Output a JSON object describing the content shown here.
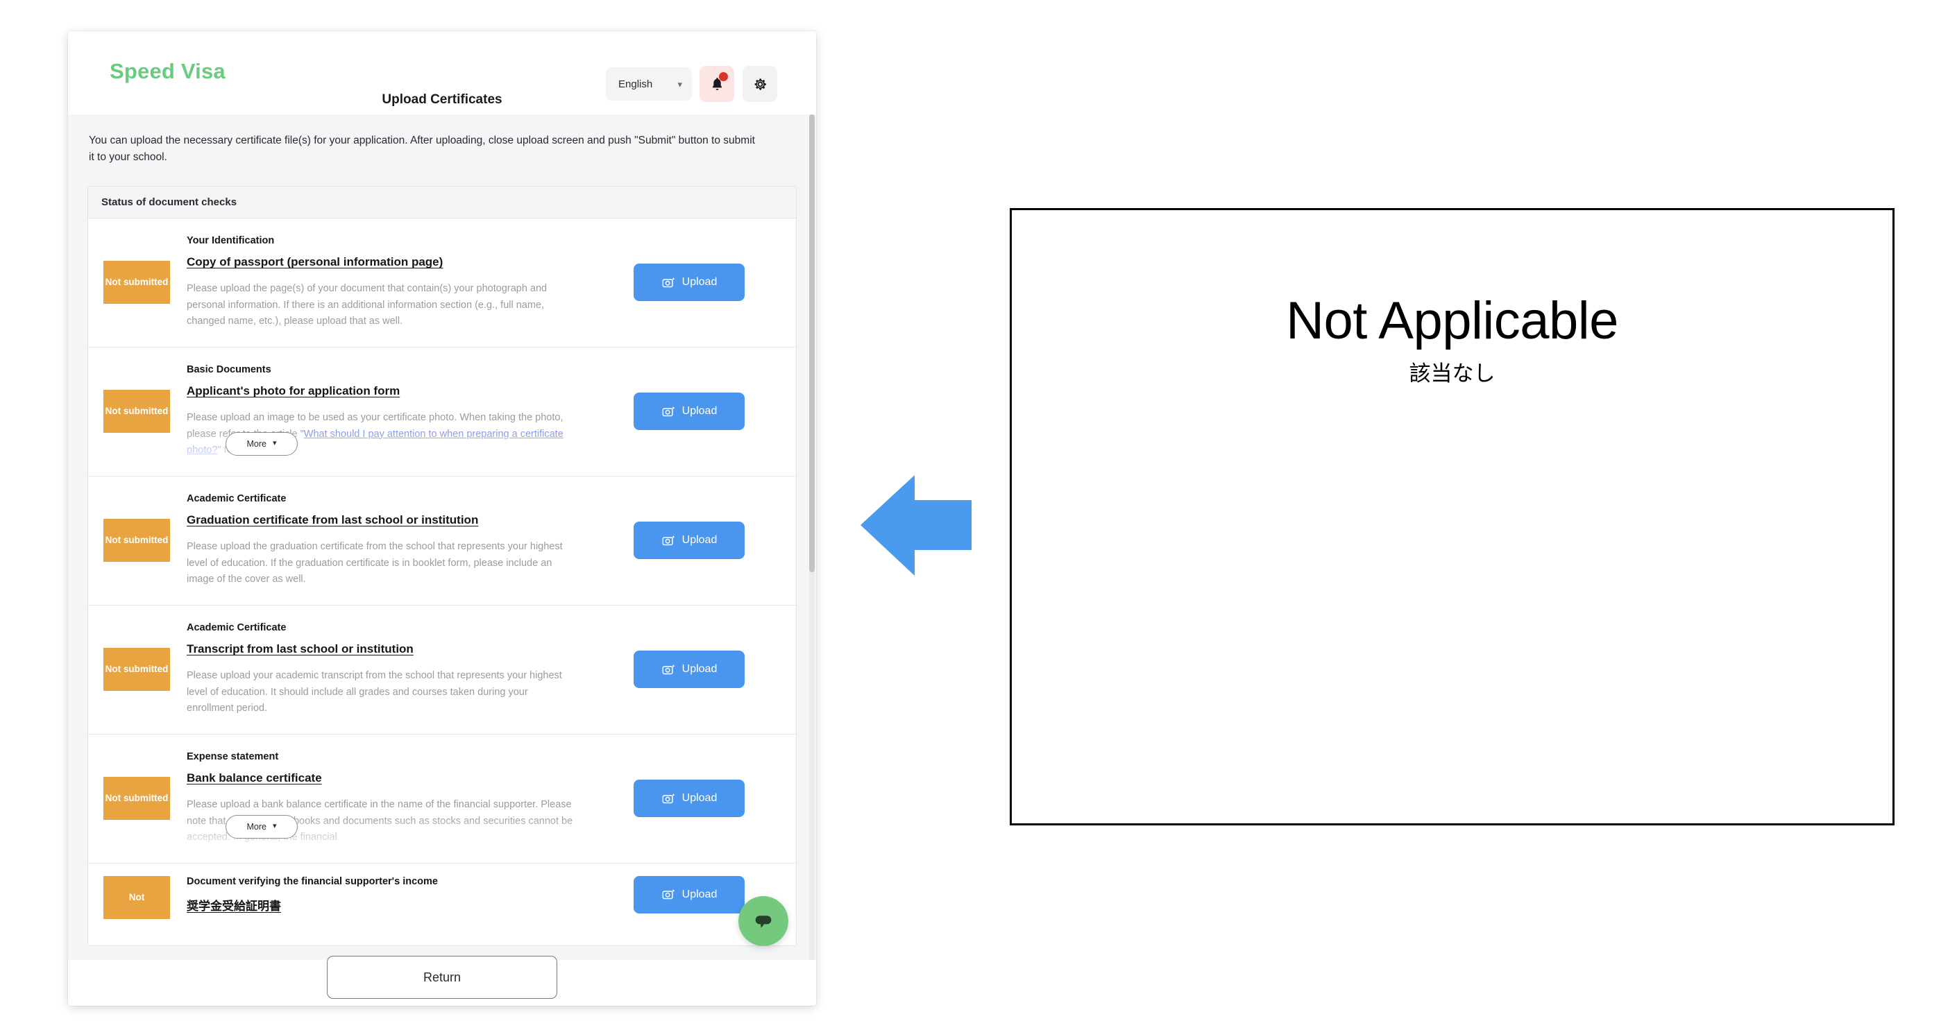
{
  "app": {
    "brand": "Speed Visa",
    "page_title": "Upload Certificates",
    "language_selected": "English",
    "language_chevron": "chevron-down",
    "intro": "You can upload the necessary certificate file(s) for your application. After uploading, close upload screen and push \"Submit\" button to submit it to your school.",
    "panel_header": "Status of document checks",
    "return_label": "Return",
    "more_label": "More",
    "upload_label": "Upload",
    "status_not_submitted": "Not submitted",
    "status_not_submitted_partial": "Not"
  },
  "colors": {
    "brand_green": "#68cb7e",
    "upload_blue": "#4a95ee",
    "status_orange": "#e8a441",
    "link_blue": "#7d8df0",
    "chat_green": "#74c97f",
    "notification_red": "#d9342b",
    "arrow_blue": "#4a9aee",
    "page_bg": "#f4f5f7"
  },
  "documents": [
    {
      "category": "Your Identification",
      "name": "Copy of passport (personal information page)",
      "description": "Please upload the page(s) of your document that contain(s) your photograph and personal information. If there is an additional information section (e.g., full name, changed name, etc.), please upload that as well.",
      "status": "Not submitted",
      "truncated": false
    },
    {
      "category": "Basic Documents",
      "name": "Applicant's photo for application form",
      "description": "Please upload an image to be used as your certificate photo. When taking the photo, please refer to the article \"What should I pay attention to when preparing a certificate photo?\" for guidance.",
      "description_link_text": "What should I pay attention to when preparing a certificate photo?",
      "status": "Not submitted",
      "truncated": true
    },
    {
      "category": "Academic Certificate",
      "name": "Graduation certificate from last school or institution",
      "description": "Please upload the graduation certificate from the school that represents your highest level of education. If the graduation certificate is in booklet form, please include an image of the cover as well.",
      "status": "Not submitted",
      "truncated": false
    },
    {
      "category": "Academic Certificate",
      "name": "Transcript from last school or institution",
      "description": "Please upload your academic transcript from the school that represents your highest level of education. It should include all grades and courses taken during your enrollment period.",
      "status": "Not submitted",
      "truncated": false
    },
    {
      "category": "Expense statement",
      "name": "Bank balance certificate",
      "description": "Please upload a bank balance certificate in the name of the financial supporter. Please note that copies of bankbooks and documents such as stocks and securities cannot be accepted. In general, the financial",
      "status": "Not submitted",
      "truncated": true
    },
    {
      "category": "Document verifying the financial supporter's income",
      "name": "奨学金受給証明書",
      "description": "",
      "status": "Not",
      "truncated": false
    }
  ],
  "annotation": {
    "title": "Not Applicable",
    "subtitle": "該当なし",
    "arrow": "left-arrow"
  }
}
